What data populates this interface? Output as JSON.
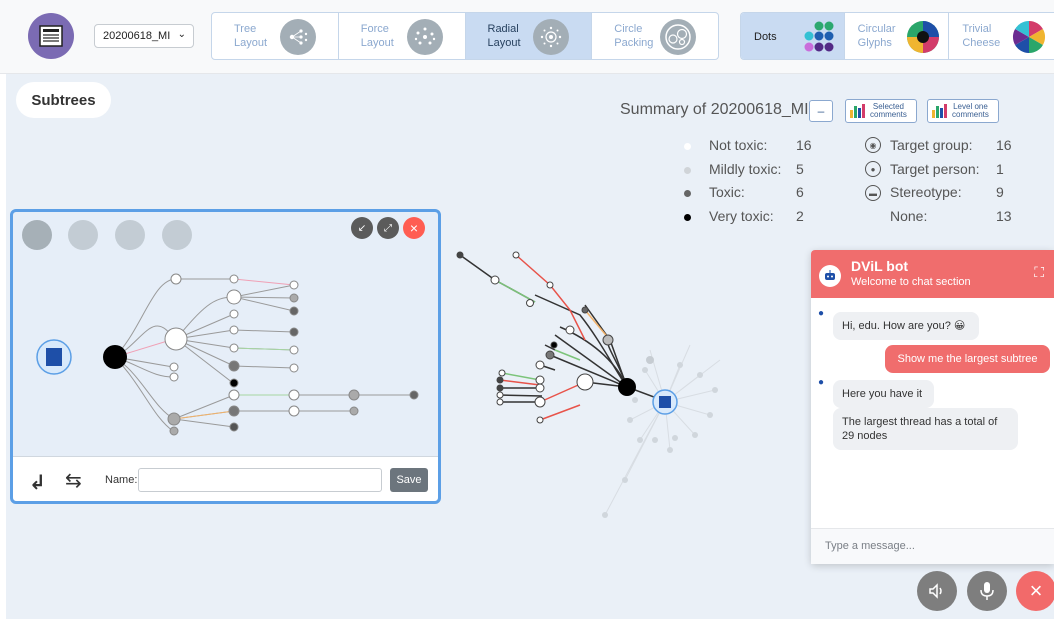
{
  "topbar": {
    "logo_text": "NEWS",
    "dataset_select": "20200618_MI",
    "layouts": [
      {
        "label_line1": "Tree",
        "label_line2": "Layout",
        "icon": "tree-layout-icon",
        "active": false
      },
      {
        "label_line1": "Force",
        "label_line2": "Layout",
        "icon": "force-layout-icon",
        "active": false
      },
      {
        "label_line1": "Radial",
        "label_line2": "Layout",
        "icon": "radial-layout-icon",
        "active": true
      },
      {
        "label_line1": "Circle",
        "label_line2": "Packing",
        "icon": "circle-packing-icon",
        "active": false
      }
    ],
    "glyphs": [
      {
        "label_line1": "Dots",
        "label_line2": "",
        "icon": "dots-icon",
        "active": true
      },
      {
        "label_line1": "Circular",
        "label_line2": "Glyphs",
        "icon": "circular-glyph-icon",
        "active": false
      },
      {
        "label_line1": "Trivial",
        "label_line2": "Cheese",
        "icon": "trivial-cheese-icon",
        "active": false
      }
    ]
  },
  "subtrees_button": "Subtrees",
  "summary": {
    "title": "Summary of 20200618_MI",
    "minus_label": "–",
    "selected_line1": "Selected",
    "selected_line2": "comments",
    "level_line1": "Level one",
    "level_line2": "comments",
    "toxicity": [
      {
        "label": "Not toxic:",
        "count": "16",
        "color": "#ffffff"
      },
      {
        "label": "Mildly toxic:",
        "count": "5",
        "color": "#d0d4d8"
      },
      {
        "label": "Toxic:",
        "count": "6",
        "color": "#666666"
      },
      {
        "label": "Very toxic:",
        "count": "2",
        "color": "#000000"
      }
    ],
    "targets": [
      {
        "label": "Target group:",
        "count": "16",
        "icon": "target-group-icon"
      },
      {
        "label": "Target person:",
        "count": "1",
        "icon": "target-person-icon"
      },
      {
        "label": "Stereotype:",
        "count": "9",
        "icon": "stereotype-icon"
      },
      {
        "label": "None:",
        "count": "13",
        "icon": ""
      }
    ]
  },
  "subtree_panel": {
    "name_label": "Name:",
    "name_value": "",
    "save_label": "Save"
  },
  "chat": {
    "title": "DViL bot",
    "subtitle": "Welcome to chat section",
    "messages": [
      {
        "from": "bot",
        "text": "Hi, edu. How are you? 😀"
      },
      {
        "from": "user",
        "text": "Show me the largest subtree"
      },
      {
        "from": "bot",
        "text": "Here you have it"
      },
      {
        "from": "bot",
        "text": "The largest thread has a total of 29 nodes"
      }
    ],
    "input_placeholder": "Type a message..."
  },
  "colors": {
    "accent_blue": "#5c9fe6",
    "chat_red": "#f06d6d",
    "edge_green": "#7cc47a",
    "edge_red": "#e8534a",
    "edge_orange": "#f2b36b"
  }
}
